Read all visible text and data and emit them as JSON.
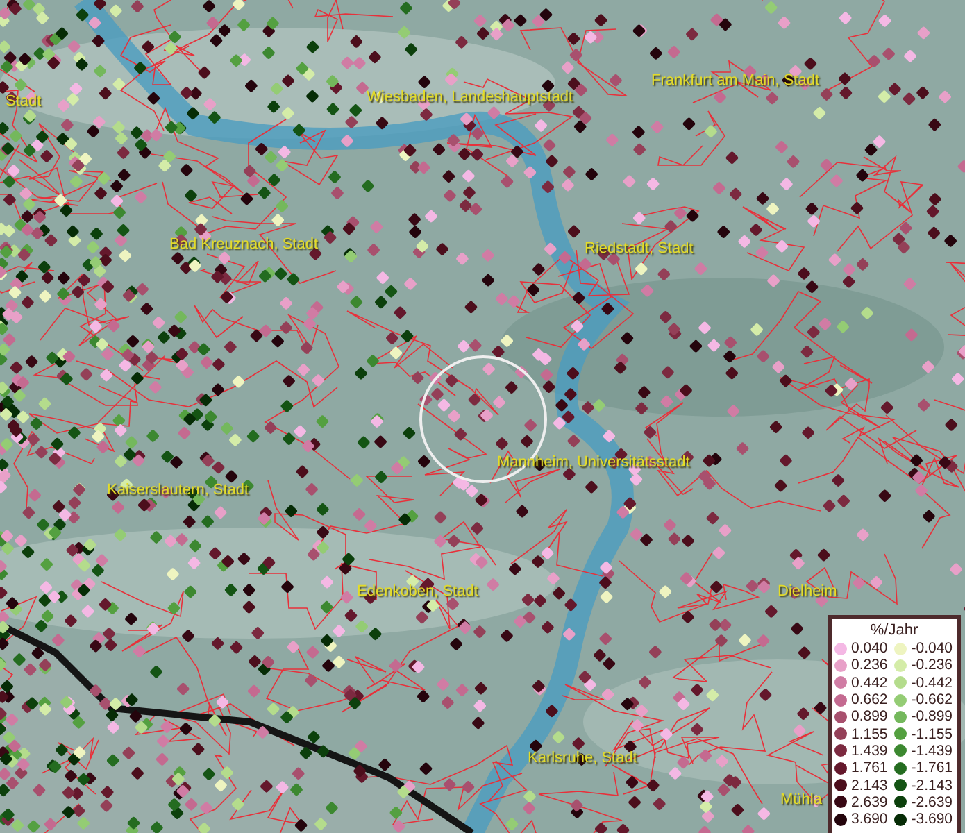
{
  "places": [
    {
      "name": "Stadt"
    },
    {
      "name": "Wiesbaden, Landeshauptstadt"
    },
    {
      "name": "Frankfurt am Main, Stadt"
    },
    {
      "name": "Bad Kreuznach, Stadt"
    },
    {
      "name": "Riedstadt, Stadt"
    },
    {
      "name": "Mannheim, Universitätsstadt"
    },
    {
      "name": "Kaiserslautern, Stadt"
    },
    {
      "name": "Edenkoben, Stadt"
    },
    {
      "name": "Dielheim"
    },
    {
      "name": "Karlsruhe, Stadt"
    },
    {
      "name": "Mühla"
    }
  ],
  "legend": {
    "title": "%/Jahr",
    "positive": [
      {
        "value": "0.040",
        "color": "#f4b8e4"
      },
      {
        "value": "0.236",
        "color": "#e8a0c8"
      },
      {
        "value": "0.442",
        "color": "#d07ca4"
      },
      {
        "value": "0.662",
        "color": "#c46a90"
      },
      {
        "value": "0.899",
        "color": "#a8506e"
      },
      {
        "value": "1.155",
        "color": "#944058"
      },
      {
        "value": "1.439",
        "color": "#7c2a40"
      },
      {
        "value": "1.761",
        "color": "#64182c"
      },
      {
        "value": "2.143",
        "color": "#4c0e1c"
      },
      {
        "value": "2.639",
        "color": "#380814"
      },
      {
        "value": "3.690",
        "color": "#24040c"
      }
    ],
    "negative": [
      {
        "value": "-0.040",
        "color": "#eef4c0"
      },
      {
        "value": "-0.236",
        "color": "#d4eca8"
      },
      {
        "value": "-0.442",
        "color": "#b4dc8c"
      },
      {
        "value": "-0.662",
        "color": "#94cc74"
      },
      {
        "value": "-0.899",
        "color": "#74b85c"
      },
      {
        "value": "-1.155",
        "color": "#54a040"
      },
      {
        "value": "-1.439",
        "color": "#3c8830"
      },
      {
        "value": "-1.761",
        "color": "#246c20"
      },
      {
        "value": "-2.143",
        "color": "#145414"
      },
      {
        "value": "-2.639",
        "color": "#0c400c"
      },
      {
        "value": "-3.690",
        "color": "#062c06"
      }
    ]
  }
}
